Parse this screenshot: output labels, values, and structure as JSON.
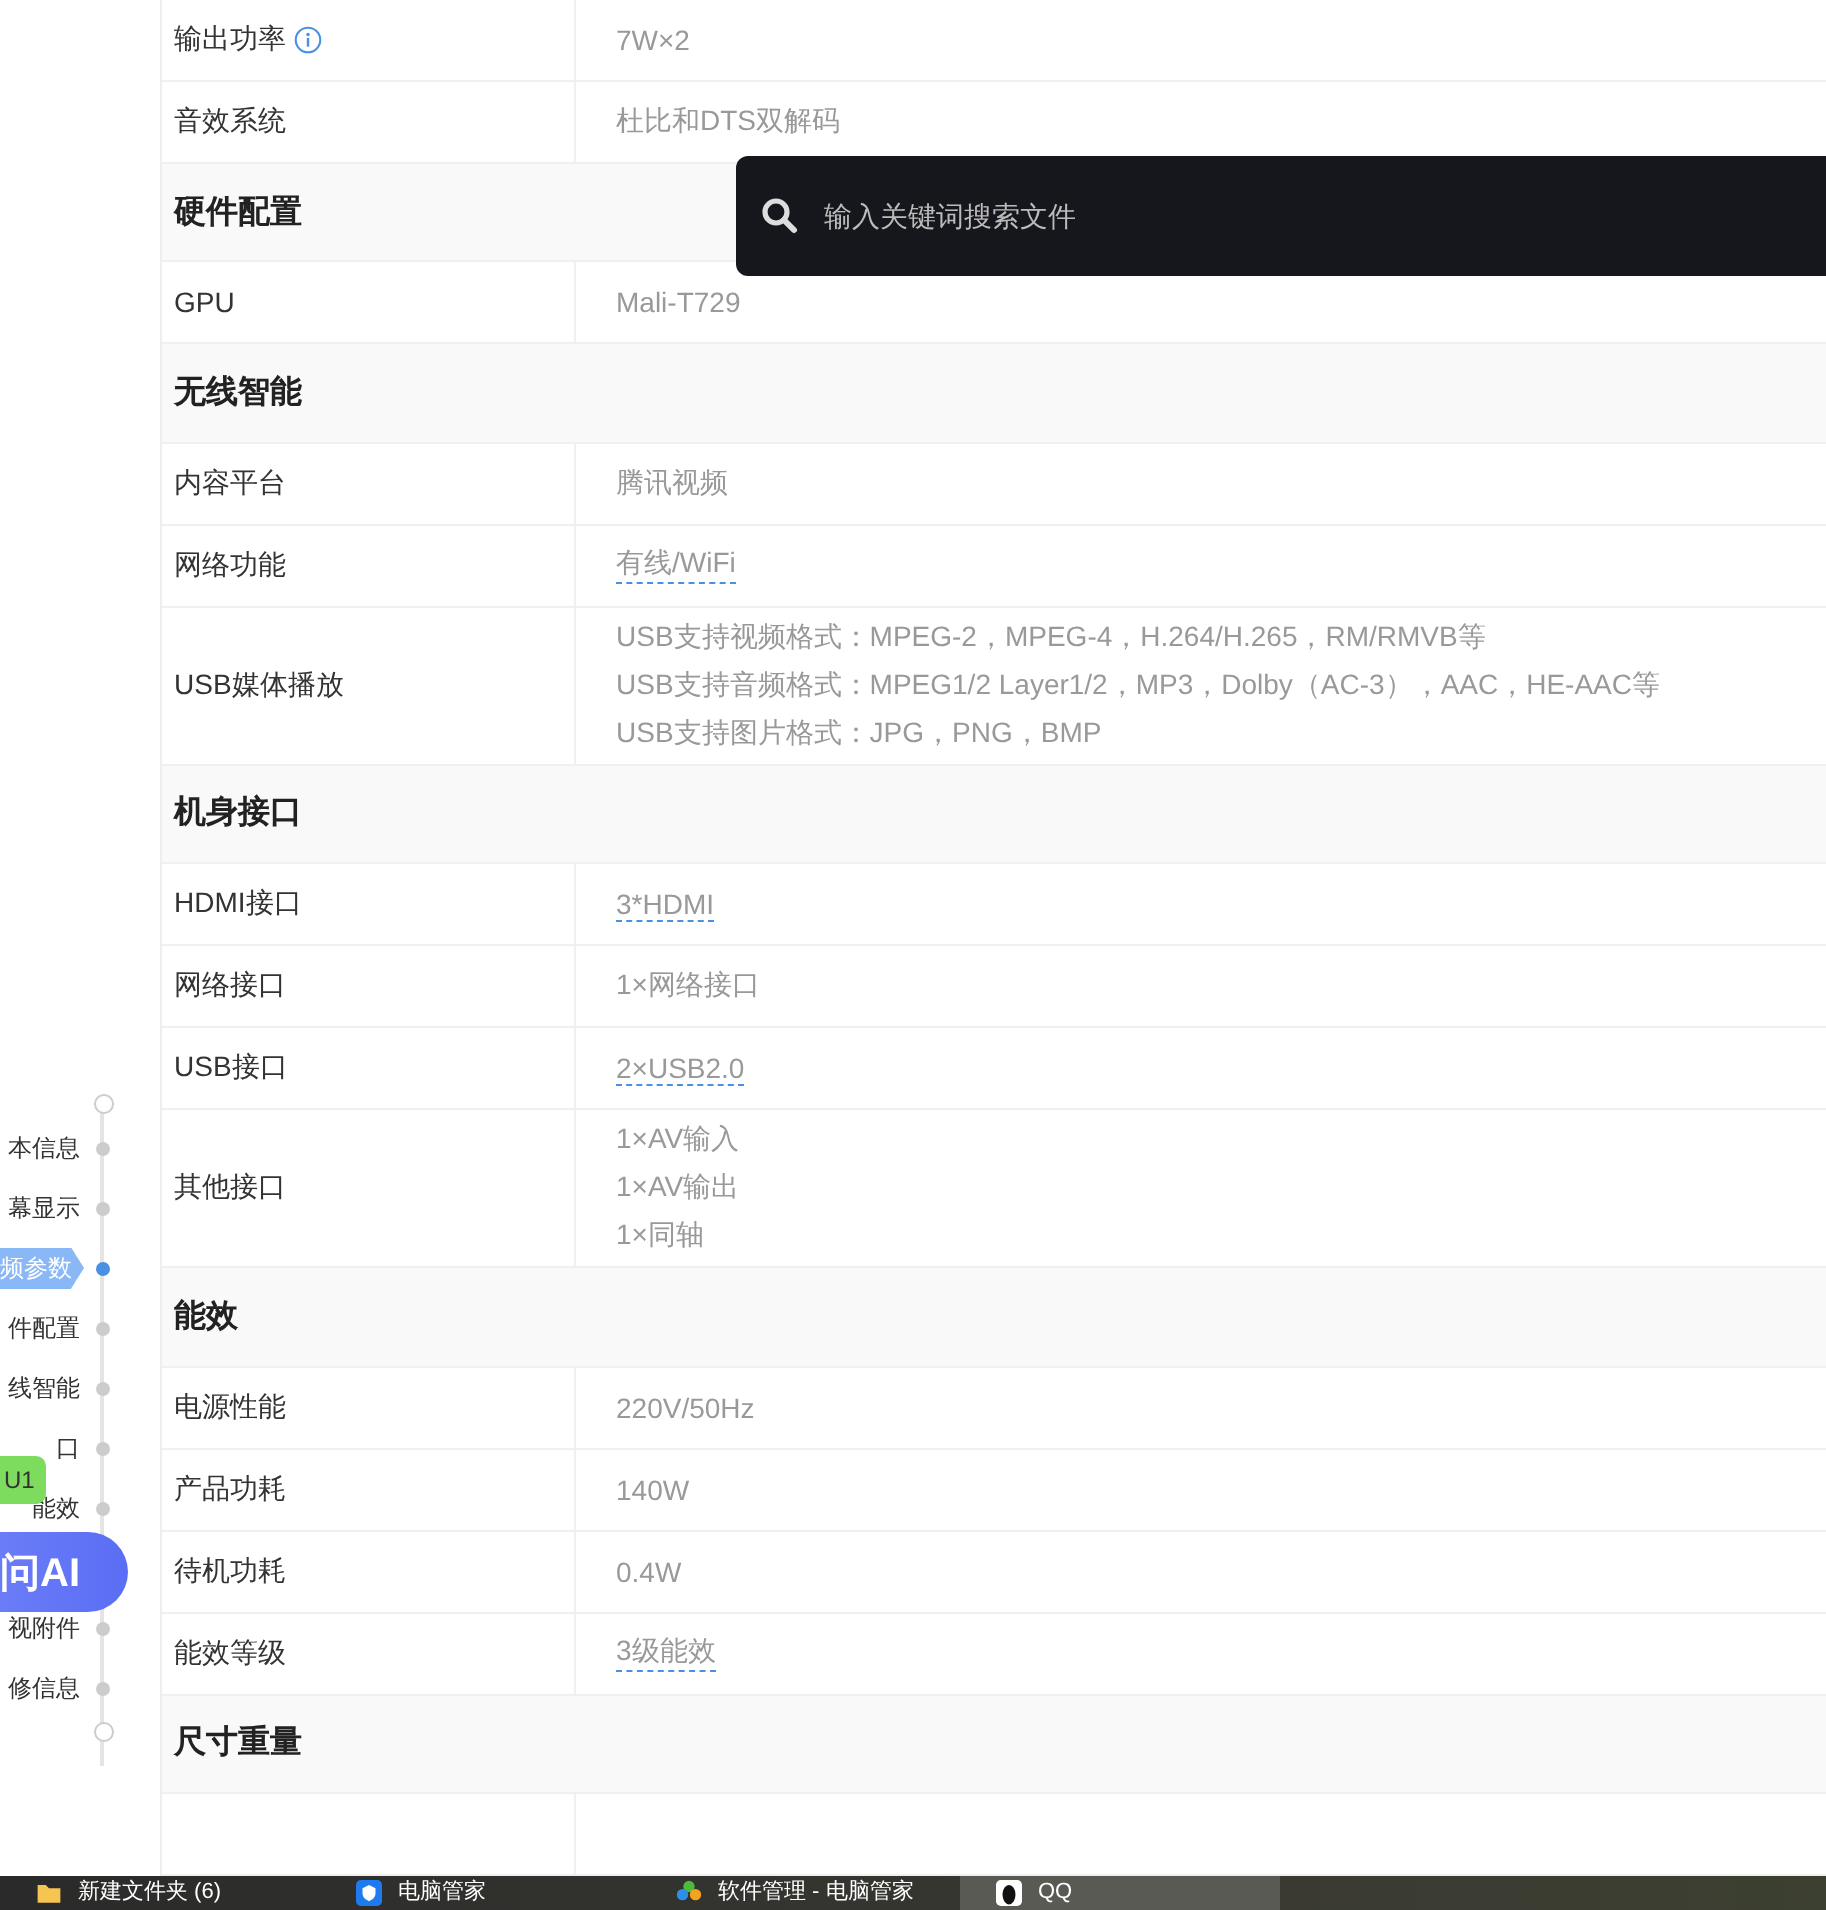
{
  "sections": [
    {
      "rows": [
        {
          "label": "输出功率",
          "info": true,
          "values": [
            "7W×2"
          ],
          "link": false
        },
        {
          "label": "音效系统",
          "values": [
            "杜比和DTS双解码"
          ],
          "link": false
        }
      ]
    },
    {
      "title": "硬件配置",
      "rows": [
        {
          "label": "GPU",
          "values": [
            "Mali-T729"
          ],
          "link": false
        }
      ]
    },
    {
      "title": "无线智能",
      "rows": [
        {
          "label": "内容平台",
          "values": [
            "腾讯视频"
          ],
          "link": false
        },
        {
          "label": "网络功能",
          "values": [
            "有线/WiFi"
          ],
          "link": true
        },
        {
          "label": "USB媒体播放",
          "values": [
            "USB支持视频格式：MPEG-2，MPEG-4，H.264/H.265，RM/RMVB等",
            "USB支持音频格式：MPEG1/2 Layer1/2，MP3，Dolby（AC-3），AAC，HE-AAC等",
            "USB支持图片格式：JPG，PNG，BMP"
          ],
          "link": false
        }
      ]
    },
    {
      "title": "机身接口",
      "rows": [
        {
          "label": "HDMI接口",
          "values": [
            "3*HDMI"
          ],
          "link": true
        },
        {
          "label": "网络接口",
          "values": [
            "1×网络接口"
          ],
          "link": false
        },
        {
          "label": "USB接口",
          "values": [
            "2×USB2.0"
          ],
          "link": true
        },
        {
          "label": "其他接口",
          "values": [
            "1×AV输入",
            "1×AV输出",
            "1×同轴"
          ],
          "link": false
        }
      ]
    },
    {
      "title": "能效",
      "rows": [
        {
          "label": "电源性能",
          "values": [
            "220V/50Hz"
          ],
          "link": false
        },
        {
          "label": "产品功耗",
          "values": [
            "140W"
          ],
          "link": false
        },
        {
          "label": "待机功耗",
          "values": [
            "0.4W"
          ],
          "link": false
        },
        {
          "label": "能效等级",
          "values": [
            "3级能效"
          ],
          "link": true
        }
      ]
    },
    {
      "title": "尺寸重量"
    }
  ],
  "search": {
    "placeholder": "输入关键词搜索文件"
  },
  "nav": [
    {
      "label": "本信息",
      "selected": false
    },
    {
      "label": "幕显示",
      "selected": false
    },
    {
      "label": "频参数",
      "selected": true
    },
    {
      "label": "件配置",
      "selected": false
    },
    {
      "label": "线智能",
      "selected": false
    },
    {
      "label": "口",
      "selected": false
    },
    {
      "label": "能效",
      "selected": false
    },
    {
      "label": "视附件",
      "selected": false
    },
    {
      "label": "修信息",
      "selected": false
    }
  ],
  "badge": "U1",
  "ai_button": "问AI",
  "taskbar": [
    {
      "kind": "folder",
      "label": "新建文件夹 (6)",
      "selected": false
    },
    {
      "kind": "shield",
      "label": "电脑管家",
      "selected": false
    },
    {
      "kind": "clover",
      "label": "软件管理 - 电脑管家",
      "selected": false
    },
    {
      "kind": "qq",
      "label": "QQ",
      "selected": true
    }
  ]
}
